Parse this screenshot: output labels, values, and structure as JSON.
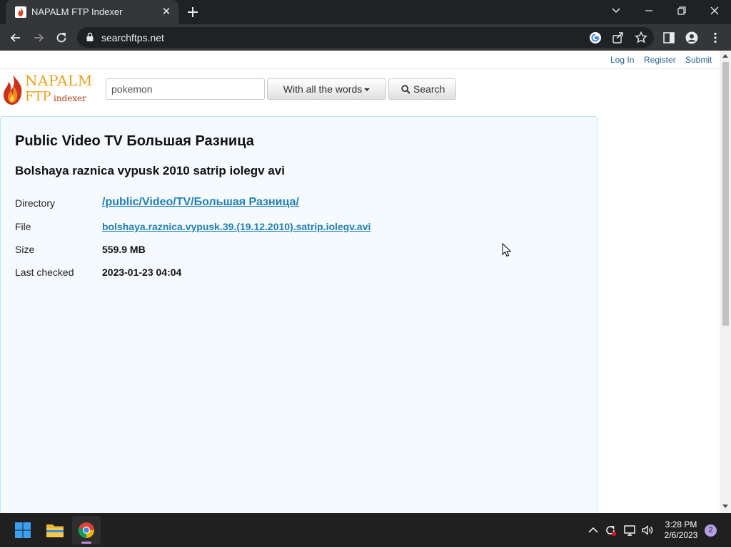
{
  "browser": {
    "tab_title": "NAPALM FTP Indexer",
    "url": "searchftps.net"
  },
  "nav": {
    "login": "Log In",
    "register": "Register",
    "submit": "Submit"
  },
  "logo": {
    "line1": "NAPALM",
    "line2": "FTP",
    "line3": "indexer"
  },
  "search": {
    "query": "pokemon",
    "mode_label": "With all the words",
    "button_label": "Search"
  },
  "result": {
    "title": "Public Video TV Большая Разница",
    "subtitle": "Bolshaya raznica vypusk 2010 satrip iolegv avi",
    "rows": [
      {
        "label": "Directory",
        "value": "/public/Video/TV/Большая Разница/"
      },
      {
        "label": "File",
        "value": "bolshaya.raznica.vypusk.39.(19.12.2010).satrip.iolegv.avi"
      },
      {
        "label": "Size",
        "value": "559.9 MB"
      },
      {
        "label": "Last checked",
        "value": "2023-01-23 04:04"
      }
    ]
  },
  "taskbar": {
    "time": "3:28 PM",
    "date": "2/6/2023",
    "notification_count": "2"
  },
  "colors": {
    "link": "#1f7fb6",
    "panel_bg": "#f5fafe",
    "panel_border": "#bce8f1",
    "chrome_dark": "#202124",
    "chrome_toolbar": "#35363a"
  }
}
